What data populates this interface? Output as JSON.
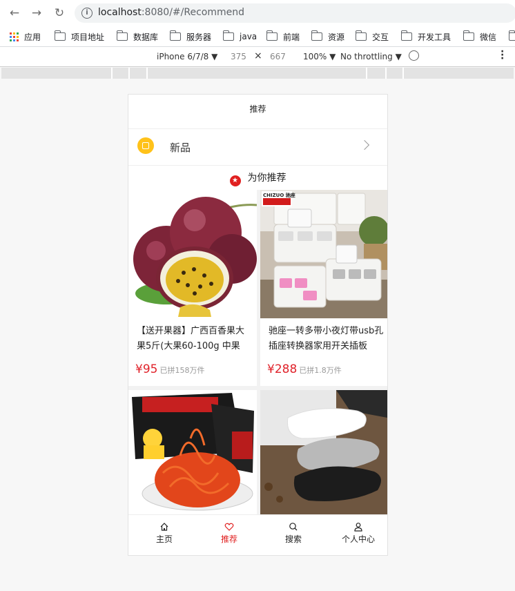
{
  "browser": {
    "url_host": "localhost",
    "url_rest": ":8080/#/Recommend",
    "bookmarks": [
      {
        "label": "应用",
        "icon": "apps-grid-icon"
      },
      {
        "label": "项目地址",
        "icon": "folder-icon"
      },
      {
        "label": "数据库",
        "icon": "folder-icon"
      },
      {
        "label": "服务器",
        "icon": "folder-icon"
      },
      {
        "label": "java",
        "icon": "folder-icon"
      },
      {
        "label": "前端",
        "icon": "folder-icon"
      },
      {
        "label": "资源",
        "icon": "folder-icon"
      },
      {
        "label": "交互",
        "icon": "folder-icon"
      },
      {
        "label": "开发工具",
        "icon": "folder-icon"
      },
      {
        "label": "微信",
        "icon": "folder-icon"
      }
    ]
  },
  "devtools": {
    "device": "iPhone 6/7/8 ▼",
    "width": "375",
    "times": "×",
    "height": "667",
    "zoom": "100% ▼",
    "throttle": "No throttling ▼"
  },
  "app": {
    "header_title": "推荐",
    "new_label": "新品",
    "section_title": "为你推荐",
    "products": [
      {
        "title": "【送开果器】广西百香果大果5斤(大果60-100g 中果",
        "price": "¥95",
        "sold": "已拼158万件",
        "image": "passion-fruit"
      },
      {
        "title": "驰座一转多带小夜灯带usb孔插座转换器家用开关插板",
        "price": "¥288",
        "sold": "已拼1.8万件",
        "image": "power-strip",
        "brand": "CHIZUO 驰座"
      },
      {
        "title": "",
        "price": "",
        "sold": "",
        "image": "spicy-noodles"
      },
      {
        "title": "",
        "price": "",
        "sold": "",
        "image": "socks"
      }
    ],
    "tabs": [
      {
        "label": "主页",
        "icon": "home-icon"
      },
      {
        "label": "推荐",
        "icon": "heart-icon",
        "active": true
      },
      {
        "label": "搜索",
        "icon": "search-icon"
      },
      {
        "label": "个人中心",
        "icon": "user-icon"
      }
    ],
    "colors": {
      "accent": "#e02020",
      "price": "#e0222a",
      "new_icon": "#ffc21a"
    }
  }
}
